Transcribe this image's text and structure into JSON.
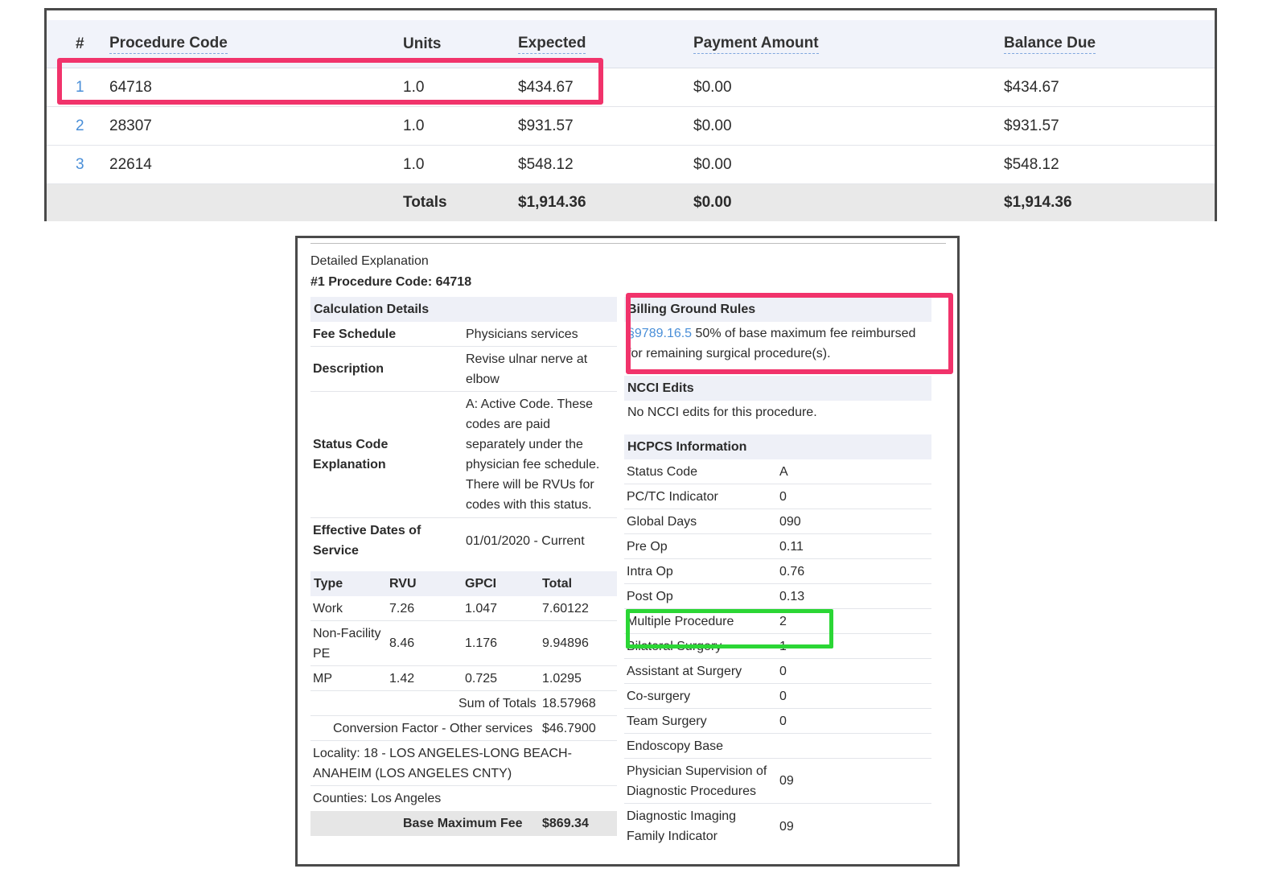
{
  "claim_table": {
    "headers": {
      "num": "#",
      "procedure_code": "Procedure Code",
      "units": "Units",
      "expected": "Expected",
      "payment_amount": "Payment Amount",
      "balance_due": "Balance Due"
    },
    "rows": [
      {
        "num": "1",
        "code": "64718",
        "units": "1.0",
        "expected": "$434.67",
        "payment": "$0.00",
        "balance": "$434.67"
      },
      {
        "num": "2",
        "code": "28307",
        "units": "1.0",
        "expected": "$931.57",
        "payment": "$0.00",
        "balance": "$931.57"
      },
      {
        "num": "3",
        "code": "22614",
        "units": "1.0",
        "expected": "$548.12",
        "payment": "$0.00",
        "balance": "$548.12"
      }
    ],
    "totals": {
      "label": "Totals",
      "expected": "$1,914.36",
      "payment": "$0.00",
      "balance": "$1,914.36"
    }
  },
  "detail": {
    "title": "Detailed Explanation",
    "subtitle": "#1 Procedure Code: 64718",
    "calc": {
      "heading": "Calculation Details",
      "fee_schedule_label": "Fee Schedule",
      "fee_schedule_value": "Physicians services",
      "description_label": "Description",
      "description_value_1": "Revise ulnar nerve at",
      "description_value_2": "elbow",
      "status_label_1": "Status Code",
      "status_label_2": "Explanation",
      "status_lines": [
        "A: Active Code. These",
        "codes are paid",
        "separately under the",
        "physician fee schedule.",
        "There will be RVUs for",
        "codes with this status."
      ],
      "eff_label_1": "Effective Dates of",
      "eff_label_2": "Service",
      "eff_value": "01/01/2020 - Current"
    },
    "rvu": {
      "headers": {
        "type": "Type",
        "rvu": "RVU",
        "gpci": "GPCI",
        "total": "Total"
      },
      "rows": [
        {
          "type": "Work",
          "type2": "",
          "rvu": "7.26",
          "gpci": "1.047",
          "total": "7.60122"
        },
        {
          "type": "Non-Facility",
          "type2": "PE",
          "rvu": "8.46",
          "gpci": "1.176",
          "total": "9.94896"
        },
        {
          "type": "MP",
          "type2": "",
          "rvu": "1.42",
          "gpci": "0.725",
          "total": "1.0295"
        }
      ],
      "sum_label": "Sum of Totals",
      "sum_value": "18.57968",
      "cf_label": "Conversion Factor - Other services",
      "cf_value": "$46.7900",
      "locality_1": "Locality: 18 - LOS ANGELES-LONG BEACH-",
      "locality_2": "ANAHEIM (LOS ANGELES CNTY)",
      "counties": "Counties: Los Angeles",
      "bmf_label": "Base Maximum Fee",
      "bmf_value": "$869.34"
    },
    "rules": {
      "heading": "Billing Ground Rules",
      "link": "§9789.16.5",
      "text_1": " 50% of base maximum fee reimbursed",
      "text_2": "for remaining surgical procedure(s)."
    },
    "ncci": {
      "heading": "NCCI Edits",
      "text": "No NCCI edits for this procedure."
    },
    "hcpcs": {
      "heading": "HCPCS Information",
      "rows": [
        {
          "k": "Status Code",
          "v": "A"
        },
        {
          "k": "PC/TC Indicator",
          "v": "0"
        },
        {
          "k": "Global Days",
          "v": "090"
        },
        {
          "k": "Pre Op",
          "v": "0.11"
        },
        {
          "k": "Intra Op",
          "v": "0.76"
        },
        {
          "k": "Post Op",
          "v": "0.13"
        },
        {
          "k": "Multiple Procedure",
          "v": "2"
        },
        {
          "k": "Bilateral Surgery",
          "v": "1"
        },
        {
          "k": "Assistant at Surgery",
          "v": "0"
        },
        {
          "k": "Co-surgery",
          "v": "0"
        },
        {
          "k": "Team Surgery",
          "v": "0"
        },
        {
          "k": "Endoscopy Base",
          "v": ""
        }
      ],
      "phys_sup_1": "Physician Supervision of",
      "phys_sup_2": "Diagnostic Procedures",
      "phys_sup_v": "09",
      "diag_img_1": "Diagnostic Imaging",
      "diag_img_2": "Family Indicator",
      "diag_img_v": "09"
    }
  },
  "colors": {
    "highlight_pink": "#f1336b",
    "highlight_green": "#2bd635",
    "link_blue": "#4a8fd8",
    "header_bg": "#f1f3fa"
  }
}
